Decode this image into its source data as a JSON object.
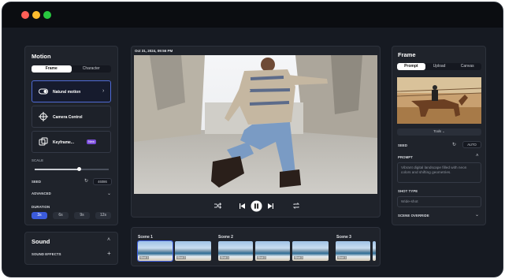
{
  "left": {
    "title": "Motion",
    "mode_tabs": [
      "Frame",
      "Character"
    ],
    "cards": [
      {
        "label": "Natural motion",
        "icon": "toggle-icon"
      },
      {
        "label": "Camera Control",
        "icon": "camera-control-icon"
      },
      {
        "label": "Keyframe...",
        "icon": "keyframe-icon",
        "badge": "New"
      }
    ],
    "scale_label": "SCALE",
    "scale_value": 0.6,
    "seed_label": "SEED",
    "seed_value": "46086",
    "advanced_label": "ADVANCED",
    "duration_label": "DURATION",
    "durations": [
      "3s",
      "6s",
      "9s",
      "12s"
    ],
    "sound_title": "Sound",
    "sound_effects_label": "SOUND EFFECTS"
  },
  "center": {
    "timestamp": "Oct 31, 2024, 09:56 PM",
    "scenes": [
      {
        "label": "Scene 1",
        "thumb_tag": "Shot 1"
      },
      {
        "label": "Scene 2",
        "thumb_tag": "Shot 1"
      },
      {
        "label": "Scene 3",
        "thumb_tag": "Shot 1"
      }
    ],
    "extra_thumb_tags": [
      "Shot 2",
      "Shot 2",
      "Shot 3"
    ]
  },
  "right": {
    "title": "Frame",
    "tabs": [
      "Prompt",
      "Upload",
      "Canvas"
    ],
    "tools_label": "Tools",
    "seed_label": "SEED",
    "seed_value": "AUTO",
    "prompt_label": "PROMPT",
    "prompt_text": "Vibrant digital landscape filled with neon colors and shifting geometries.",
    "shot_type_label": "SHOT TYPE",
    "shot_type_placeholder": "Wide-shot",
    "scene_override_label": "SCENE OVERRIDE"
  },
  "colors": {
    "accent": "#3b5bdb",
    "badge": "#7b4ddb",
    "bg": "#161a22"
  }
}
